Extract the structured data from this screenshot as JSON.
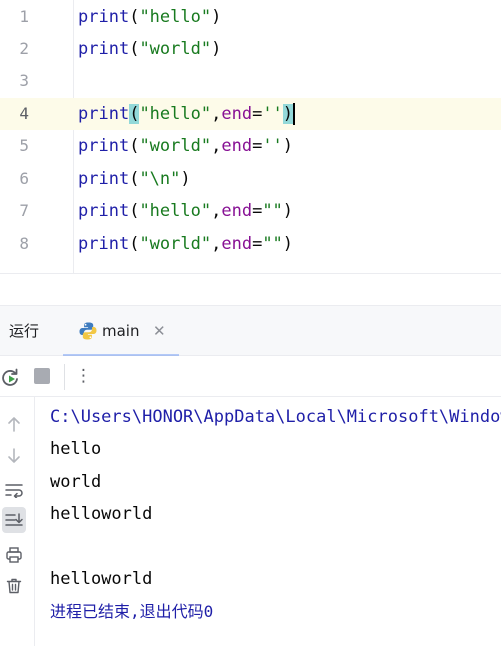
{
  "editor": {
    "lines": [
      {
        "num": "1"
      },
      {
        "num": "2"
      },
      {
        "num": "3"
      },
      {
        "num": "4"
      },
      {
        "num": "5"
      },
      {
        "num": "6"
      },
      {
        "num": "7"
      },
      {
        "num": "8"
      }
    ],
    "tokens": {
      "print": "print",
      "hello_str": "\"hello\"",
      "world_str": "\"world\"",
      "newline_str": "\"\\n\"",
      "end_kw": "end",
      "empty_single": "''",
      "empty_double": "\"\""
    }
  },
  "run_panel": {
    "title": "运行",
    "tab_label": "main",
    "tab_close": "✕",
    "more_label": "⋮"
  },
  "console": {
    "command_path": "C:\\Users\\HONOR\\AppData\\Local\\Microsoft\\WindowsApps\\python.exe",
    "output_lines": [
      "hello",
      "world",
      "helloworld",
      "",
      "helloworld"
    ],
    "exit_message": "进程已结束,退出代码0"
  },
  "colors": {
    "function": "#1f1fa8",
    "string": "#187a1f",
    "keyword_arg": "#871094",
    "bracket_match": "#93d9d9",
    "current_line": "#fdfbe9"
  },
  "icons": {
    "rerun": "rerun-icon",
    "stop": "stop-icon",
    "more": "more-vertical-icon",
    "up": "arrow-up-icon",
    "down": "arrow-down-icon",
    "soft_wrap": "soft-wrap-icon",
    "scroll_to_end": "scroll-to-end-icon",
    "print": "print-icon",
    "trash": "trash-icon",
    "python": "python-icon"
  }
}
